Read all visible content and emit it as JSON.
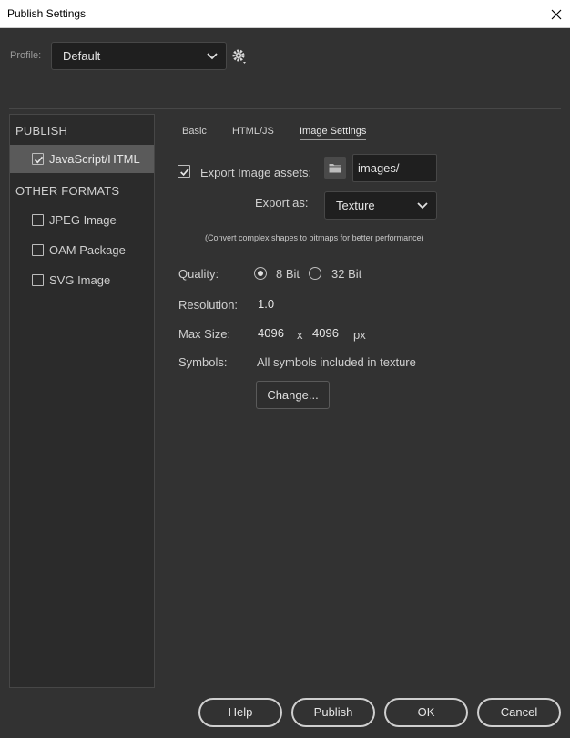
{
  "window": {
    "title": "Publish Settings"
  },
  "profile": {
    "label": "Profile:",
    "value": "Default"
  },
  "sidebar": {
    "publish_heading": "PUBLISH",
    "publish_items": [
      {
        "label": "JavaScript/HTML",
        "checked": true
      }
    ],
    "other_heading": "OTHER FORMATS",
    "other_items": [
      {
        "label": "JPEG Image",
        "checked": false
      },
      {
        "label": "OAM Package",
        "checked": false
      },
      {
        "label": "SVG Image",
        "checked": false
      }
    ]
  },
  "tabs": [
    {
      "label": "Basic",
      "active": false
    },
    {
      "label": "HTML/JS",
      "active": false
    },
    {
      "label": "Image Settings",
      "active": true
    }
  ],
  "image_settings": {
    "export_assets_label": "Export Image assets:",
    "export_assets_checked": true,
    "assets_path": "images/",
    "export_as_label": "Export as:",
    "export_as_value": "Texture",
    "hint": "(Convert complex shapes to bitmaps for better performance)",
    "quality_label": "Quality:",
    "quality_options": [
      {
        "label": "8 Bit",
        "selected": true
      },
      {
        "label": "32 Bit",
        "selected": false
      }
    ],
    "resolution_label": "Resolution:",
    "resolution_value": "1.0",
    "max_size_label": "Max Size:",
    "max_width": "4096",
    "max_sep": "x",
    "max_height": "4096",
    "max_unit": "px",
    "symbols_label": "Symbols:",
    "symbols_value": "All symbols included in texture",
    "change_label": "Change..."
  },
  "footer": {
    "help": "Help",
    "publish": "Publish",
    "ok": "OK",
    "cancel": "Cancel"
  },
  "colors": {
    "background": "#323232",
    "field": "#1f1f1f",
    "sidebar_active": "#5a5a5a"
  }
}
